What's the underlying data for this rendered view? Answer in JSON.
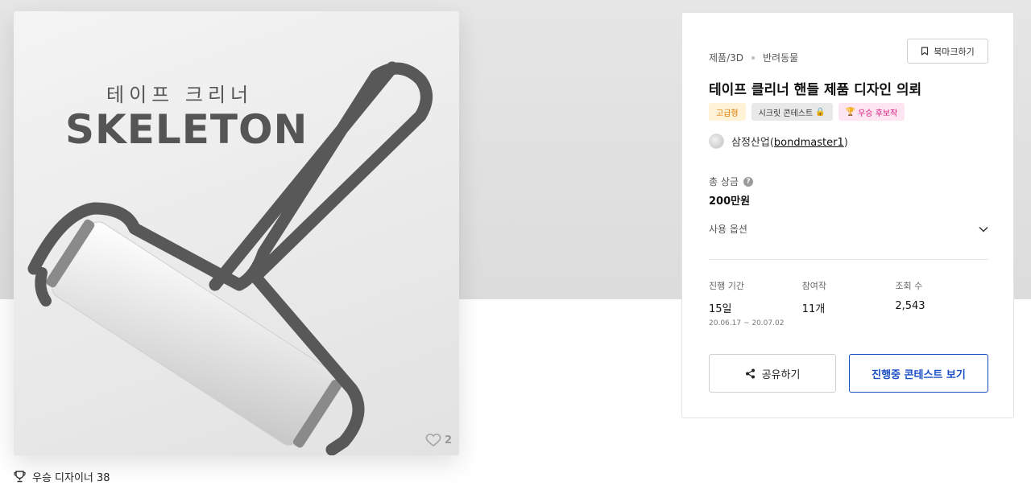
{
  "image": {
    "title_kr": "테이프 크리너",
    "title_en": "SKELETON",
    "like_count": "2"
  },
  "winner_designer": "우승 디자이너 38",
  "panel": {
    "category": "제품/3D",
    "subcategory": "반려동물",
    "bookmark_label": "북마크하기",
    "title": "테이프 클리너 핸들 제품 디자인 의뢰",
    "badges": {
      "premium": "고급형",
      "secret": "시크릿 콘테스트",
      "winner": "우승 후보작"
    },
    "host_name": "삼정산업",
    "host_id": "bondmaster1",
    "prize_label": "총 상금",
    "prize_value": "200만원",
    "usage_label": "사용 옵션",
    "stats": {
      "period_label": "진행 기간",
      "period_value": "15일",
      "period_range": "20.06.17 ~ 20.07.02",
      "participants_label": "참여작",
      "participants_value": "11개",
      "views_label": "조회 수",
      "views_value": "2,543"
    },
    "share_label": "공유하기",
    "contest_label": "진행중 콘테스트 보기"
  },
  "colors": {
    "accent": "#1a4fc4",
    "premium": "#d97a00",
    "winner": "#d6197f"
  }
}
